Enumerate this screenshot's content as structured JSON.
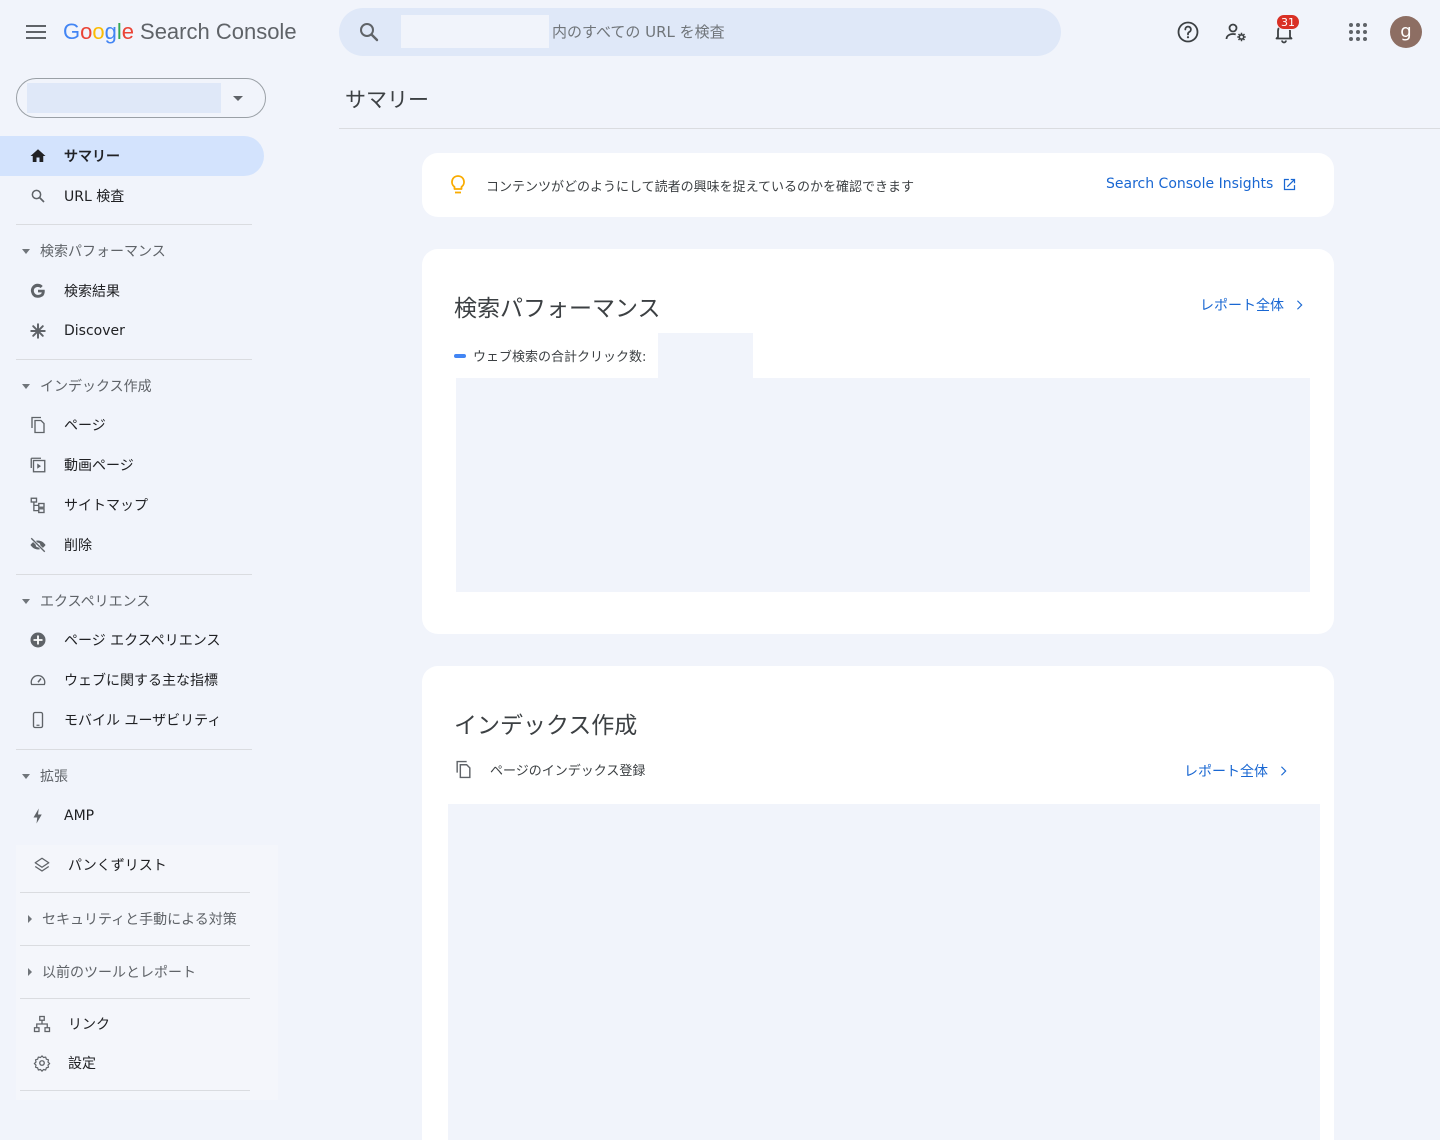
{
  "app": {
    "logo_letters": [
      "G",
      "o",
      "o",
      "g",
      "l",
      "e"
    ],
    "product": "Search Console"
  },
  "header": {
    "search_placeholder": "内のすべての URL を検査",
    "notification_count": "31",
    "avatar_initial": "g"
  },
  "sidebar": {
    "top_items": [
      {
        "label": "サマリー",
        "icon": "home-icon",
        "active": true
      },
      {
        "label": "URL 検査",
        "icon": "search-icon"
      }
    ],
    "sections": [
      {
        "title": "検索パフォーマンス",
        "items": [
          {
            "label": "検索結果",
            "icon": "google-g-icon"
          },
          {
            "label": "Discover",
            "icon": "asterisk-icon"
          }
        ]
      },
      {
        "title": "インデックス作成",
        "items": [
          {
            "label": "ページ",
            "icon": "pages-icon"
          },
          {
            "label": "動画ページ",
            "icon": "video-page-icon"
          },
          {
            "label": "サイトマップ",
            "icon": "sitemap-icon"
          },
          {
            "label": "削除",
            "icon": "eye-off-icon"
          }
        ]
      },
      {
        "title": "エクスペリエンス",
        "items": [
          {
            "label": "ページ エクスペリエンス",
            "icon": "plus-circle-icon"
          },
          {
            "label": "ウェブに関する主な指標",
            "icon": "speedometer-icon"
          },
          {
            "label": "モバイル ユーザビリティ",
            "icon": "phone-icon"
          }
        ]
      },
      {
        "title": "拡張",
        "items": [
          {
            "label": "AMP",
            "icon": "bolt-icon"
          },
          {
            "label": "パンくずリスト",
            "icon": "layers-icon"
          }
        ]
      }
    ],
    "collapsed_sections": [
      "セキュリティと手動による対策",
      "以前のツールとレポート"
    ],
    "bottom_items": [
      {
        "label": "リンク",
        "icon": "links-icon"
      },
      {
        "label": "設定",
        "icon": "settings-icon"
      }
    ]
  },
  "main": {
    "page_title": "サマリー",
    "insights": {
      "text": "コンテンツがどのようにして読者の興味を捉えているのかを確認できます",
      "link": "Search Console Insights"
    },
    "performance": {
      "title": "検索パフォーマンス",
      "report_link": "レポート全体",
      "legend": "ウェブ検索の合計クリック数:"
    },
    "indexing": {
      "title": "インデックス作成",
      "report_link": "レポート全体",
      "subtitle": "ページのインデックス登録"
    }
  },
  "colors": {
    "background": "#f1f4fb",
    "accent": "#1967d2",
    "active_nav": "#d3e3fd",
    "badge": "#d93025",
    "avatar": "#8d6e63",
    "insights_bulb": "#f9ab00"
  }
}
